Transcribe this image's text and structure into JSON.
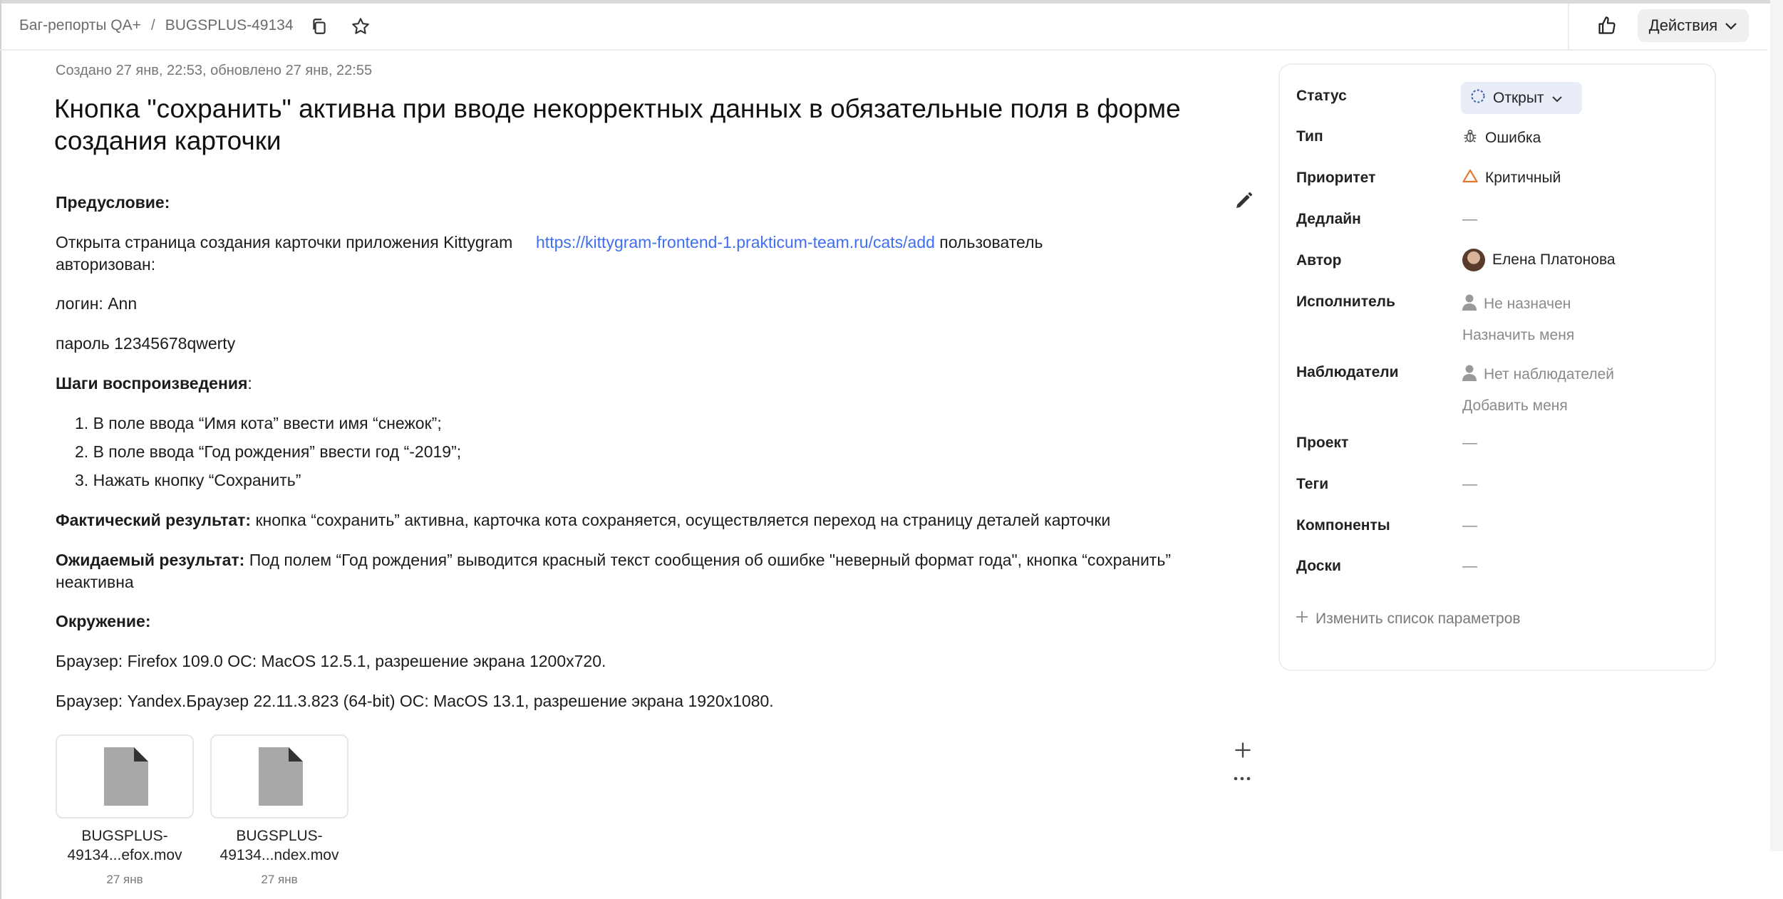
{
  "header": {
    "breadcrumb_queue": "Баг-репорты QA+",
    "breadcrumb_sep": "/",
    "issue_key": "BUGSPLUS-49134",
    "actions_label": "Действия"
  },
  "issue": {
    "meta": "Создано 27 янв, 22:53, обновлено 27 янв, 22:55",
    "title": "Кнопка \"сохранить\" активна при вводе некорректных данных в обязательные поля в форме создания карточки",
    "precondition_heading": "Предусловие:",
    "precondition_text": "Открыта страница создания карточки приложения Kittygram",
    "precondition_link": "https://kittygram-frontend-1.prakticum-team.ru/cats/add",
    "precondition_tail_1": "пользователь",
    "precondition_tail_2": "авторизован:",
    "login": "логин: Ann",
    "password": "пароль 12345678qwerty",
    "steps_heading": "Шаги воспроизведения",
    "steps_colon": ":",
    "steps": [
      "1. В поле ввода “Имя кота” ввести имя “снежок”;",
      "2. В поле ввода “Год рождения” ввести год “-2019”;",
      "3. Нажать кнопку “Сохранить”"
    ],
    "actual_heading": "Фактический результат:",
    "actual_text": "кнопка “сохранить” активна, карточка кота сохраняется, осуществляется переход на страницу деталей карточки",
    "expected_heading": "Ожидаемый результат:",
    "expected_text_1": "Под полем “Год рождения” выводится красный текст сообщения об ошибке \"неверный формат года\", кнопка “сохранить”",
    "expected_text_2": "неактивна",
    "env_heading": "Окружение:",
    "env_1": "Браузер: Firefox 109.0 ОС: MacOS 12.5.1, разрешение экрана 1200x720.",
    "env_2": "Браузер: Yandex.Браузер 22.11.3.823 (64-bit) ОС: MacOS 13.1, разрешение экрана 1920x1080."
  },
  "attachments": [
    {
      "name_1": "BUGSPLUS-",
      "name_2": "49134...efox.mov",
      "date": "27 янв"
    },
    {
      "name_1": "BUGSPLUS-",
      "name_2": "49134...ndex.mov",
      "date": "27 янв"
    }
  ],
  "sidebar": {
    "status_label": "Статус",
    "status_value": "Открыт",
    "type_label": "Тип",
    "type_value": "Ошибка",
    "priority_label": "Приоритет",
    "priority_value": "Критичный",
    "deadline_label": "Дедлайн",
    "deadline_value": "—",
    "author_label": "Автор",
    "author_value": "Елена Платонова",
    "assignee_label": "Исполнитель",
    "assignee_value": "Не назначен",
    "assign_me": "Назначить меня",
    "watchers_label": "Наблюдатели",
    "watchers_value": "Нет наблюдателей",
    "add_me": "Добавить меня",
    "project_label": "Проект",
    "project_value": "—",
    "tags_label": "Теги",
    "tags_value": "—",
    "components_label": "Компоненты",
    "components_value": "—",
    "boards_label": "Доски",
    "boards_value": "—",
    "edit_params": "Изменить список параметров"
  },
  "colors": {
    "link": "#3f6ff0",
    "priority_icon": "#e8752f",
    "status_bg": "#e8edf7"
  }
}
